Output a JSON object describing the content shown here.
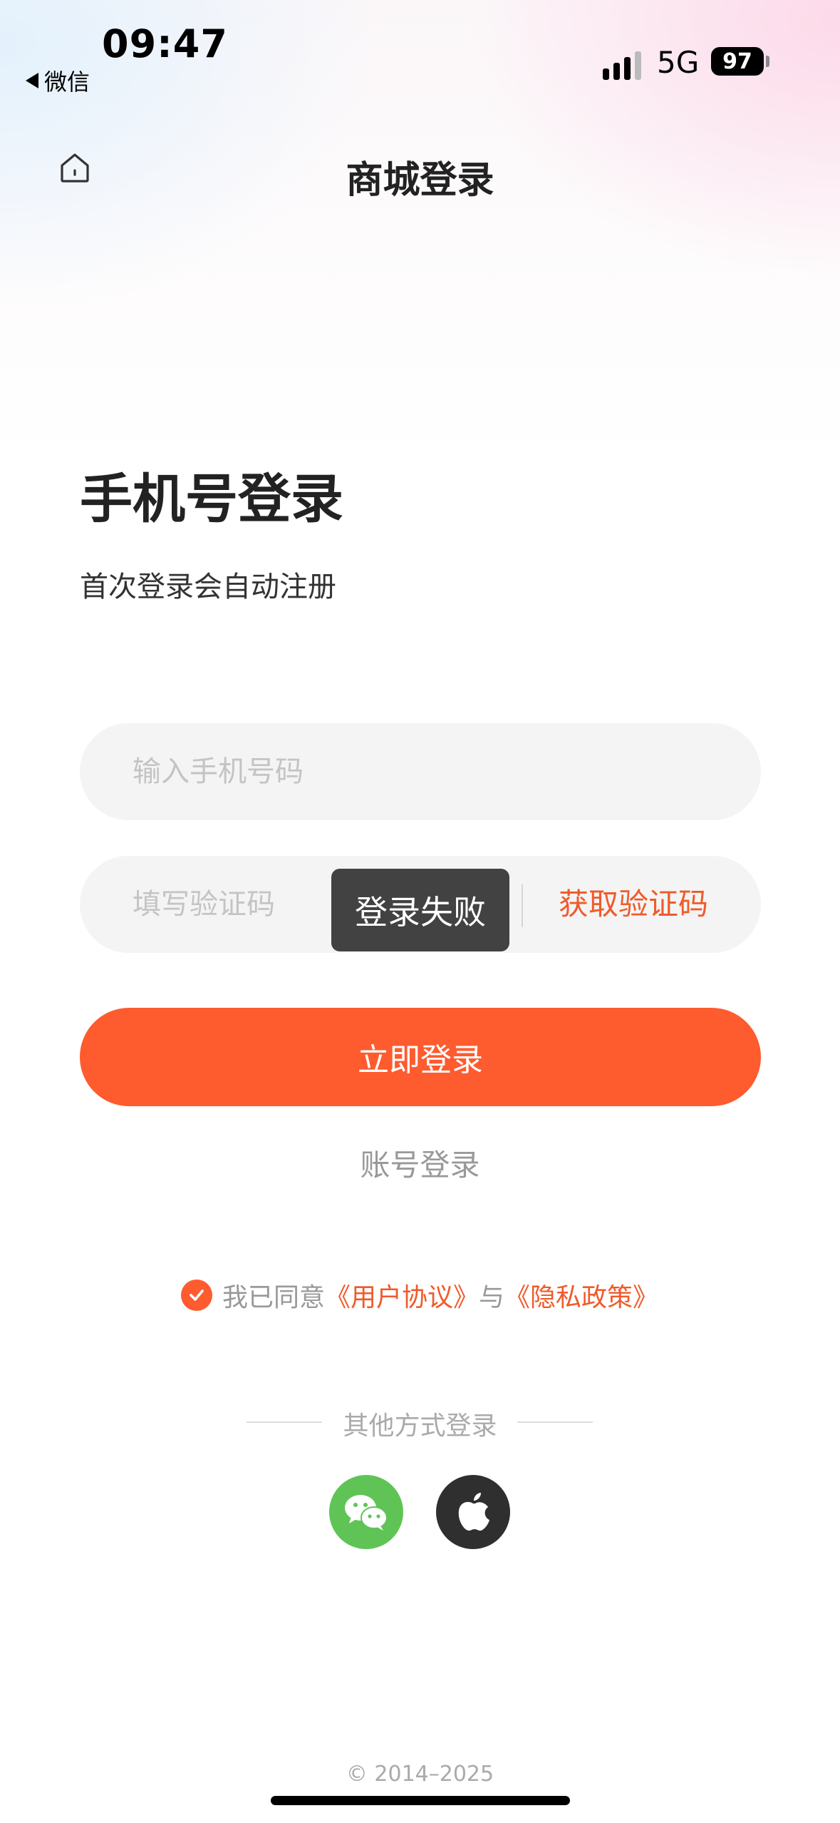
{
  "status_bar": {
    "time": "09:47",
    "back_app": "微信",
    "network": "5G",
    "battery": "97"
  },
  "header": {
    "title": "商城登录",
    "home_icon": "home-icon"
  },
  "login": {
    "heading": "手机号登录",
    "subheading": "首次登录会自动注册",
    "phone_placeholder": "输入手机号码",
    "phone_value": "",
    "code_placeholder": "填写验证码",
    "code_value": "",
    "get_code": "获取验证码",
    "submit": "立即登录",
    "account_login": "账号登录"
  },
  "toast": {
    "message": "登录失败"
  },
  "agreement": {
    "checked": true,
    "prefix": "我已同意",
    "user_agreement": "《用户协议》",
    "and": "与",
    "privacy_policy": "《隐私政策》"
  },
  "other_login": {
    "label": "其他方式登录",
    "methods": [
      "wechat-icon",
      "apple-icon"
    ]
  },
  "footer": {
    "copyright": "© 2014–2025"
  },
  "colors": {
    "accent": "#fe5b2f",
    "link": "#f05a2a",
    "wechat": "#5fc455",
    "apple": "#2f2f2f",
    "toast_bg": "#424242"
  }
}
